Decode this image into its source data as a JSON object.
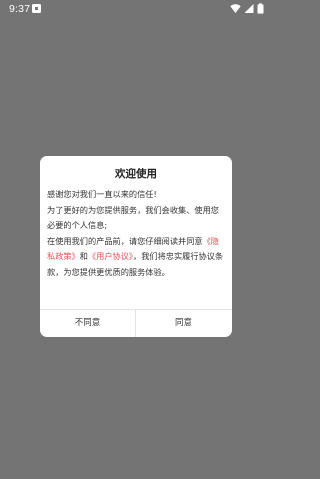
{
  "status_bar": {
    "time": "9:37",
    "icons": [
      "app-notification-icon",
      "wifi-icon",
      "cellular-signal-icon",
      "battery-icon"
    ]
  },
  "dialog": {
    "title": "欢迎使用",
    "line1": "感谢您对我们一直以来的信任!",
    "line2": "为了更好的为您提供服务，我们会收集、使用您必要的个人信息;",
    "line3_before": "在使用我们的产品前，请您仔细阅读并同意",
    "privacy_link": "《隐私政策》",
    "and": "和",
    "user_agreement_link": "《用户协议》",
    "line3_after": "，我们将忠实履行协议条款，为您提供更优质的服务体验。",
    "disagree_label": "不同意",
    "agree_label": "同意"
  },
  "colors": {
    "overlay_background": "#747474",
    "link": "#e8525b",
    "dialog_background": "#ffffff"
  }
}
